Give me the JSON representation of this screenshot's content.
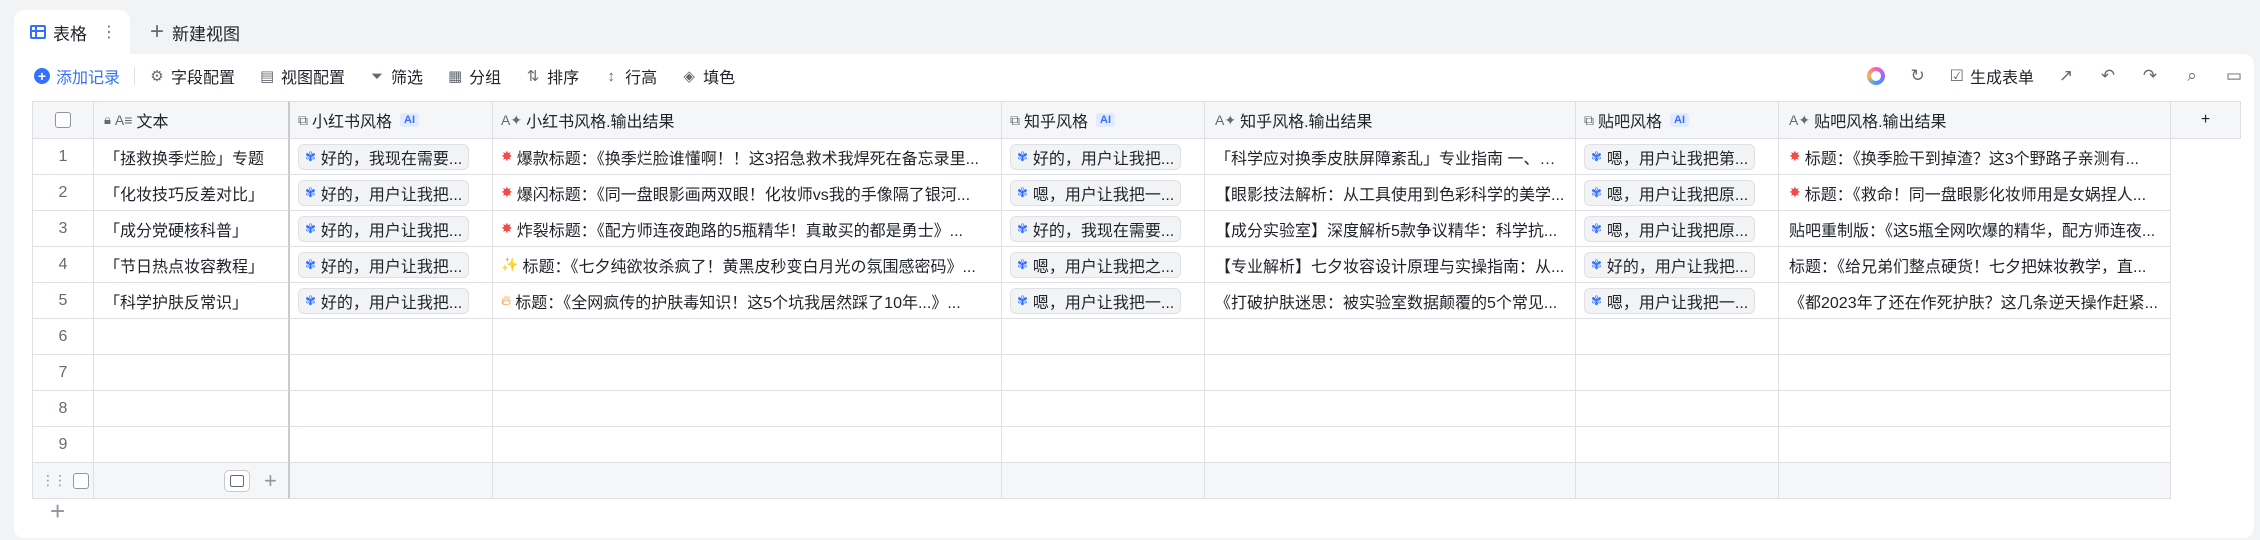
{
  "tabs": [
    {
      "label": "表格",
      "icon": "table-icon",
      "active": true
    },
    {
      "label": "新建视图",
      "icon": "plus-icon",
      "active": false
    }
  ],
  "toolbar": {
    "add_record": "添加记录",
    "field_config": "字段配置",
    "view_config": "视图配置",
    "filter": "筛选",
    "group": "分组",
    "sort": "排序",
    "row_height": "行高",
    "fill_color": "填色",
    "generate_form": "生成表单"
  },
  "columns": {
    "text": "文本",
    "xhs": "小红书风格",
    "xhs_result": "小红书风格.输出结果",
    "zhihu": "知乎风格",
    "zhihu_result": "知乎风格.输出结果",
    "tieba": "贴吧风格",
    "tieba_result": "贴吧风格.输出结果",
    "ai_tag": "AI"
  },
  "rows": [
    {
      "index": "1",
      "text": "「拯救换季烂脸」专题",
      "xhs": "好的，我现在需要...",
      "xhs_result": "爆款标题：《换季烂脸谁懂啊！！这3招急救术我焊死在备忘录里...",
      "zhihu": "好的，用户让我把...",
      "zhihu_result": "「科学应对换季皮肤屏障紊乱」专业指南 一、换...",
      "tieba": "嗯，用户让我把第...",
      "tieba_result": "标题：《换季脸干到掉渣？这3个野路子亲测有..."
    },
    {
      "index": "2",
      "text": "「化妆技巧反差对比」",
      "xhs": "好的，用户让我把...",
      "xhs_result": "爆闪标题：《同一盘眼影画两双眼！化妆师vs我的手像隔了银河...",
      "zhihu": "嗯，用户让我把一...",
      "zhihu_result": "【眼影技法解析：从工具使用到色彩科学的美学...",
      "tieba": "嗯，用户让我把原...",
      "tieba_result": "标题：《救命！同一盘眼影化妆师用是女娲捏人..."
    },
    {
      "index": "3",
      "text": "「成分党硬核科普」",
      "xhs": "好的，用户让我把...",
      "xhs_result": "炸裂标题：《配方师连夜跑路的5瓶精华！真敢买的都是勇士》...",
      "zhihu": "好的，我现在需要...",
      "zhihu_result": "【成分实验室】深度解析5款争议精华：科学抗...",
      "tieba": "嗯，用户让我把原...",
      "tieba_result": "贴吧重制版：《这5瓶全网吹爆的精华，配方师连夜..."
    },
    {
      "index": "4",
      "text": "「节日热点妆容教程」",
      "xhs": "好的，用户让我把...",
      "xhs_result": "标题：《七夕纯欲妆杀疯了！黄黑皮秒变白月光の氛围感密码》...",
      "zhihu": "嗯，用户让我把之...",
      "zhihu_result": "【专业解析】七夕妆容设计原理与实操指南：从...",
      "tieba": "好的，用户让我把...",
      "tieba_result": "标题：《给兄弟们整点硬货！七夕把妹妆教学，直..."
    },
    {
      "index": "5",
      "text": "「科学护肤反常识」",
      "xhs": "好的，用户让我把...",
      "xhs_result": "标题：《全网疯传的护肤毒知识！这5个坑我居然踩了10年...》...",
      "zhihu": "嗯，用户让我把一...",
      "zhihu_result": "《打破护肤迷思：被实验室数据颠覆的5个常见...",
      "tieba": "嗯，用户让我把一...",
      "tieba_result": "《都2023年了还在作死护肤？这几条逆天操作赶紧..."
    }
  ],
  "empty_rows": [
    "6",
    "7",
    "8",
    "9"
  ]
}
